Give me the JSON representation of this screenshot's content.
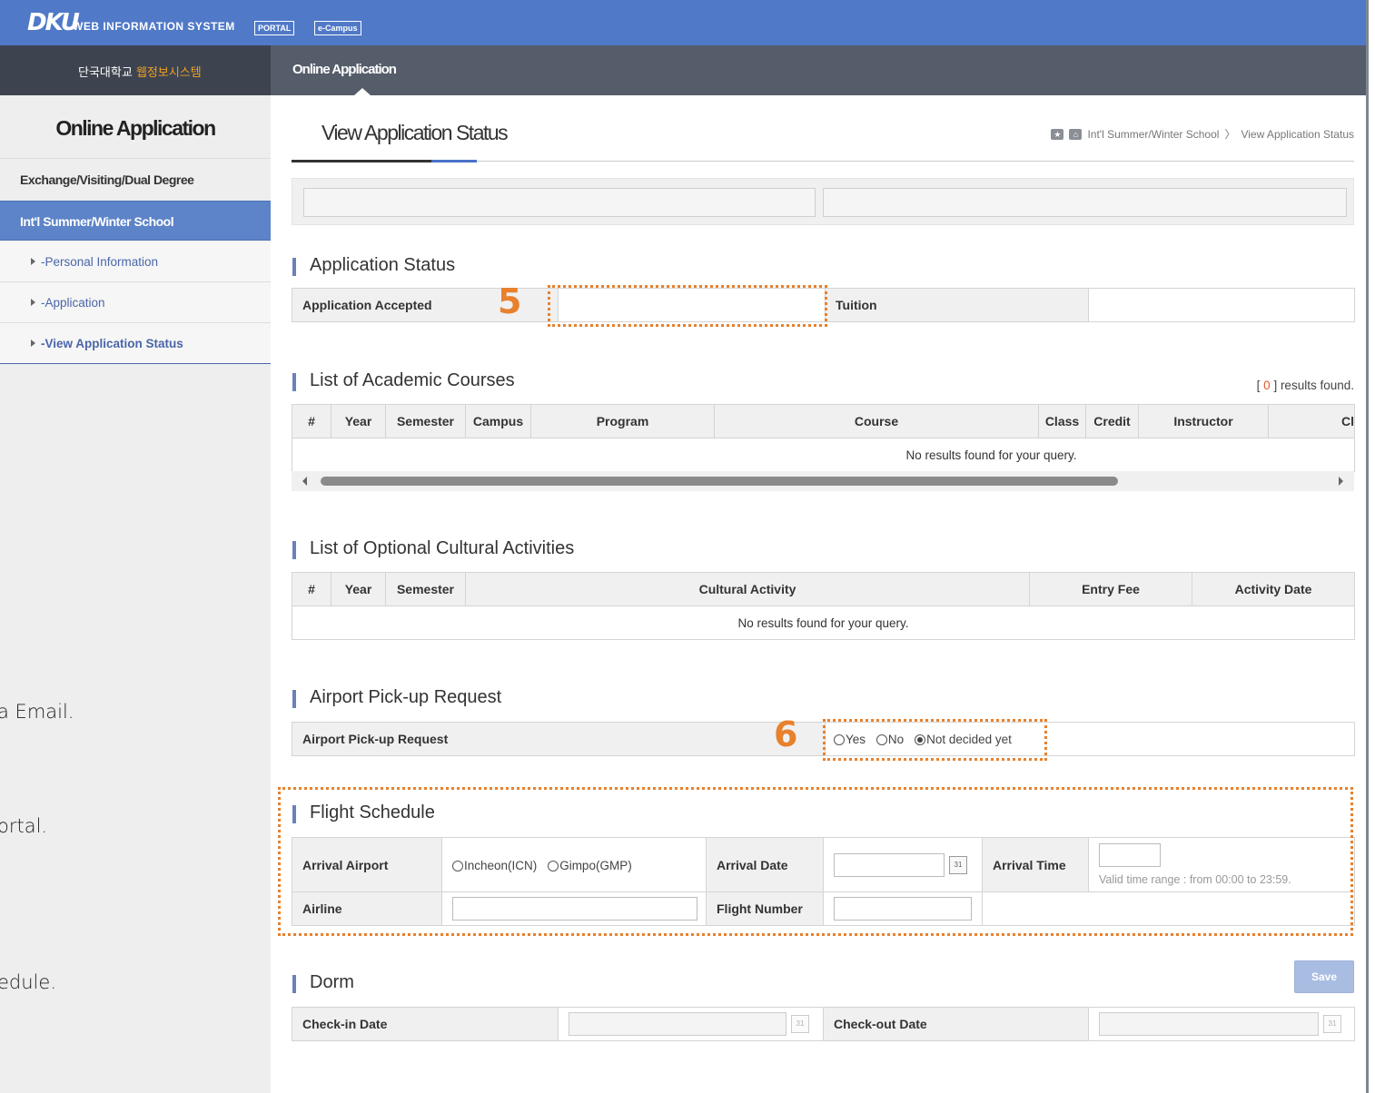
{
  "topbar": {
    "logo": "DKU",
    "system_name": "WEB INFORMATION SYSTEM",
    "tabs": [
      "PORTAL",
      "e-Campus"
    ]
  },
  "navbar": {
    "left_title_prefix": "단국대학교 ",
    "left_title_highlight": "웹정보시스템",
    "active_tab": "Online Application"
  },
  "sidebar": {
    "title": "Online Application",
    "groups": [
      "Exchange/Visiting/Dual Degree",
      "Int'l Summer/Winter School"
    ],
    "items": [
      "-Personal Information",
      "-Application",
      "-View Application Status"
    ],
    "notes": [
      "a Email.",
      "ortal.",
      "edule."
    ]
  },
  "page": {
    "title": "View Application Status",
    "breadcrumb": [
      "Int'l Summer/Winter School",
      "View Application Status"
    ],
    "breadcrumb_sep": "〉"
  },
  "application_status": {
    "title": "Application Status",
    "accepted_label": "Application Accepted",
    "accepted_value": "",
    "tuition_label": "Tuition",
    "tuition_value": ""
  },
  "academic_courses": {
    "title": "List of Academic Courses",
    "count_prefix": "[ ",
    "count": "0",
    "count_suffix": " ] results found.",
    "columns": [
      "#",
      "Year",
      "Semester",
      "Campus",
      "Program",
      "Course",
      "Class",
      "Credit",
      "Instructor",
      "Cl"
    ],
    "empty": "No results found for your query."
  },
  "cultural_activities": {
    "title": "List of Optional Cultural Activities",
    "columns": [
      "#",
      "Year",
      "Semester",
      "Cultural Activity",
      "Entry Fee",
      "Activity Date"
    ],
    "empty": "No results found for your query."
  },
  "airport_pickup": {
    "title": "Airport Pick-up Request",
    "label": "Airport Pick-up Request",
    "options": [
      "Yes",
      "No",
      "Not decided yet"
    ],
    "selected": "Not decided yet"
  },
  "flight_schedule": {
    "title": "Flight Schedule",
    "arrival_airport_label": "Arrival Airport",
    "airport_options": [
      "Incheon(ICN)",
      "Gimpo(GMP)"
    ],
    "arrival_date_label": "Arrival Date",
    "arrival_date_value": "",
    "arrival_time_label": "Arrival Time",
    "arrival_time_value": "",
    "time_hint": "Valid time range : from 00:00 to 23:59.",
    "airline_label": "Airline",
    "airline_value": "",
    "flight_number_label": "Flight Number",
    "flight_number_value": ""
  },
  "dorm": {
    "title": "Dorm",
    "checkin_label": "Check-in Date",
    "checkout_label": "Check-out Date"
  },
  "save_label": "Save",
  "callouts": [
    "5",
    "6"
  ],
  "colors": {
    "topbar": "#5079c8",
    "nav_dark": "#3d4450",
    "sidebar_active": "#5d83c8",
    "callout": "#e8812d"
  }
}
